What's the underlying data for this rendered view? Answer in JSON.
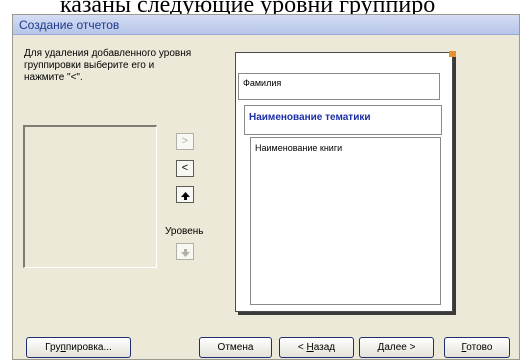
{
  "page_caption": "казаны следующие уровни группиро",
  "dialog": {
    "title": "Создание отчетов",
    "instruction": "Для удаления добавленного уровня\nгруппировки выберите его и\nнажмите \"<\".",
    "arrows": {
      "add": ">",
      "remove": "<"
    },
    "level_label": "Уровень",
    "preview": {
      "levels": [
        {
          "label": "Фамилия"
        },
        {
          "label": "Наименование тематики"
        },
        {
          "label": "Наименование книги"
        }
      ]
    },
    "buttons": {
      "grouping_pre": "Гру",
      "grouping_accel": "п",
      "grouping_post": "пировка...",
      "cancel": "Отмена",
      "back_pre": "< ",
      "back_accel": "Н",
      "back_post": "азад",
      "next_accel": "Д",
      "next_post": "алее >",
      "finish_accel": "Г",
      "finish_post": "отово"
    }
  },
  "colors": {
    "dialog_bg": "#ece9d8",
    "title_text": "#1e3a8a",
    "group_highlight": "#1c2fa6",
    "preview_marker": "#e7912e"
  }
}
